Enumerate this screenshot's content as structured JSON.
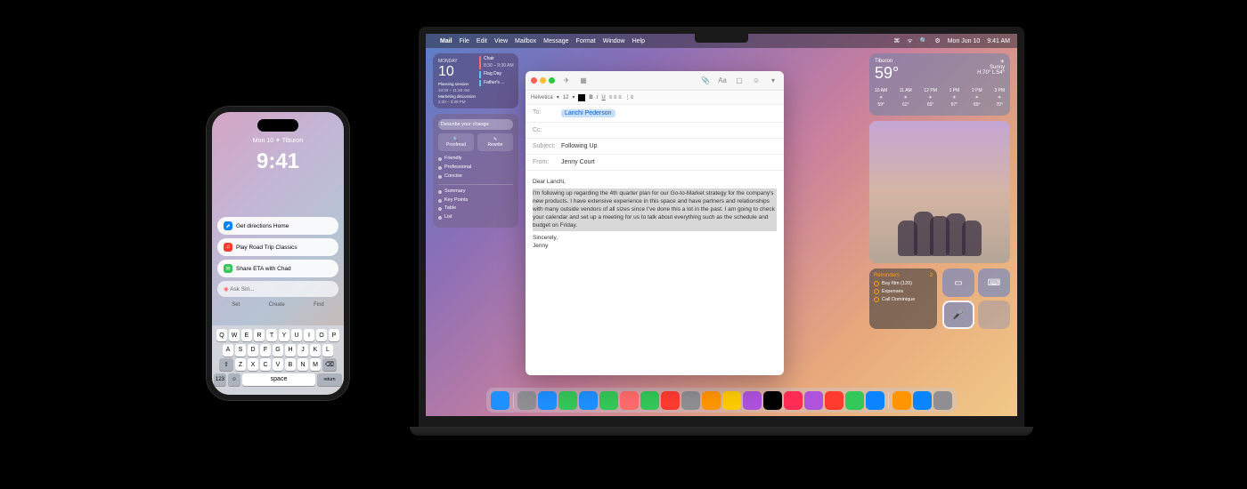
{
  "iphone": {
    "status": "Mon 10  ✦  Tiburon",
    "time": "9:41",
    "suggestions": [
      {
        "icon": "maps",
        "label": "Get directions Home"
      },
      {
        "icon": "music",
        "label": "Play Road Trip Classics"
      },
      {
        "icon": "messages",
        "label": "Share ETA with Chad"
      }
    ],
    "siri_placeholder": "Ask Siri...",
    "siri_tabs": [
      "Set",
      "Create",
      "Find"
    ],
    "keyboard": {
      "row1": [
        "Q",
        "W",
        "E",
        "R",
        "T",
        "Y",
        "U",
        "I",
        "O",
        "P"
      ],
      "row2": [
        "A",
        "S",
        "D",
        "F",
        "G",
        "H",
        "J",
        "K",
        "L"
      ],
      "row3": [
        "Z",
        "X",
        "C",
        "V",
        "B",
        "N",
        "M"
      ],
      "space": "space",
      "return": "return"
    }
  },
  "menubar": {
    "app_menu": [
      "",
      "Mail",
      "File",
      "Edit",
      "View",
      "Mailbox",
      "Message",
      "Format",
      "Window",
      "Help"
    ],
    "right": {
      "date": "Mon Jun 10",
      "time": "9:41 AM"
    }
  },
  "calendar_widget": {
    "day_label": "MONDAY",
    "day_num": "10",
    "events": [
      {
        "title": "Chair",
        "time": "8:30 – 9:30 AM"
      },
      {
        "title": "Planning session",
        "time": "10:00 – 11:30 AM"
      },
      {
        "title": "Flag Day",
        "time": ""
      },
      {
        "title": "Marketing discussion",
        "time": "2:30 – 3:30 PM"
      },
      {
        "title": "Father's ...",
        "time": ""
      }
    ]
  },
  "writing_tools": {
    "input_placeholder": "Describe your change",
    "proofread": "Proofread",
    "rewrite": "Rewrite",
    "styles": [
      "Friendly",
      "Professional",
      "Concise"
    ],
    "actions": [
      "Summary",
      "Key Points",
      "Table",
      "List"
    ]
  },
  "mail": {
    "font_label": "Helvetica",
    "font_size": "12",
    "to_label": "To:",
    "to_value": "Lanchi Pederson",
    "cc_label": "Cc:",
    "subject_label": "Subject:",
    "subject_value": "Following Up",
    "from_label": "From:",
    "from_value": "Jenny Court",
    "body_greeting": "Dear Lanchi,",
    "body_text": "I'm following up regarding the 4th quarter plan for our Go-to-Market strategy for the company's new products. I have extensive experience in this space and have partners and relationships with many outside vendors of all sizes since I've done this a lot in the past. I am going to check your calendar and set up a meeting for us to talk about everything such as the schedule and budget on Friday.",
    "body_close": "Sincerely,",
    "body_sig": "Jenny"
  },
  "weather": {
    "location": "Tiburon",
    "temp": "59°",
    "cond": "Sunny",
    "hilo": "H:70° L:54°",
    "hours": [
      {
        "t": "10 AM",
        "d": "59°"
      },
      {
        "t": "11 AM",
        "d": "62°"
      },
      {
        "t": "12 PM",
        "d": "65°"
      },
      {
        "t": "1 PM",
        "d": "67°"
      },
      {
        "t": "2 PM",
        "d": "69°"
      },
      {
        "t": "3 PM",
        "d": "70°"
      }
    ]
  },
  "reminders": {
    "title": "Reminders",
    "count": "3",
    "items": [
      "Buy film (120)",
      "Expenses",
      "Call Dominique"
    ]
  },
  "dock": {
    "apps": [
      "Finder",
      "Launchpad",
      "Safari",
      "Messages",
      "Mail",
      "Maps",
      "Photos",
      "FaceTime",
      "Calendar",
      "Contacts",
      "Reminders",
      "Notes",
      "Freeform",
      "TV",
      "Music",
      "Podcasts",
      "News",
      "Numbers",
      "Keynote",
      "Pages",
      "AppStore",
      "Settings"
    ],
    "colors": [
      "#1e90ff",
      "#8e8e93",
      "#1e90ff",
      "#34c759",
      "#1e90ff",
      "#34c759",
      "#ff6b6b",
      "#34c759",
      "#ff3b30",
      "#8e8e93",
      "#ff9500",
      "#ffcc00",
      "#af52de",
      "#000",
      "#ff2d55",
      "#af52de",
      "#ff3b30",
      "#34c759",
      "#0a84ff",
      "#ff9500",
      "#0a84ff",
      "#8e8e93"
    ]
  }
}
